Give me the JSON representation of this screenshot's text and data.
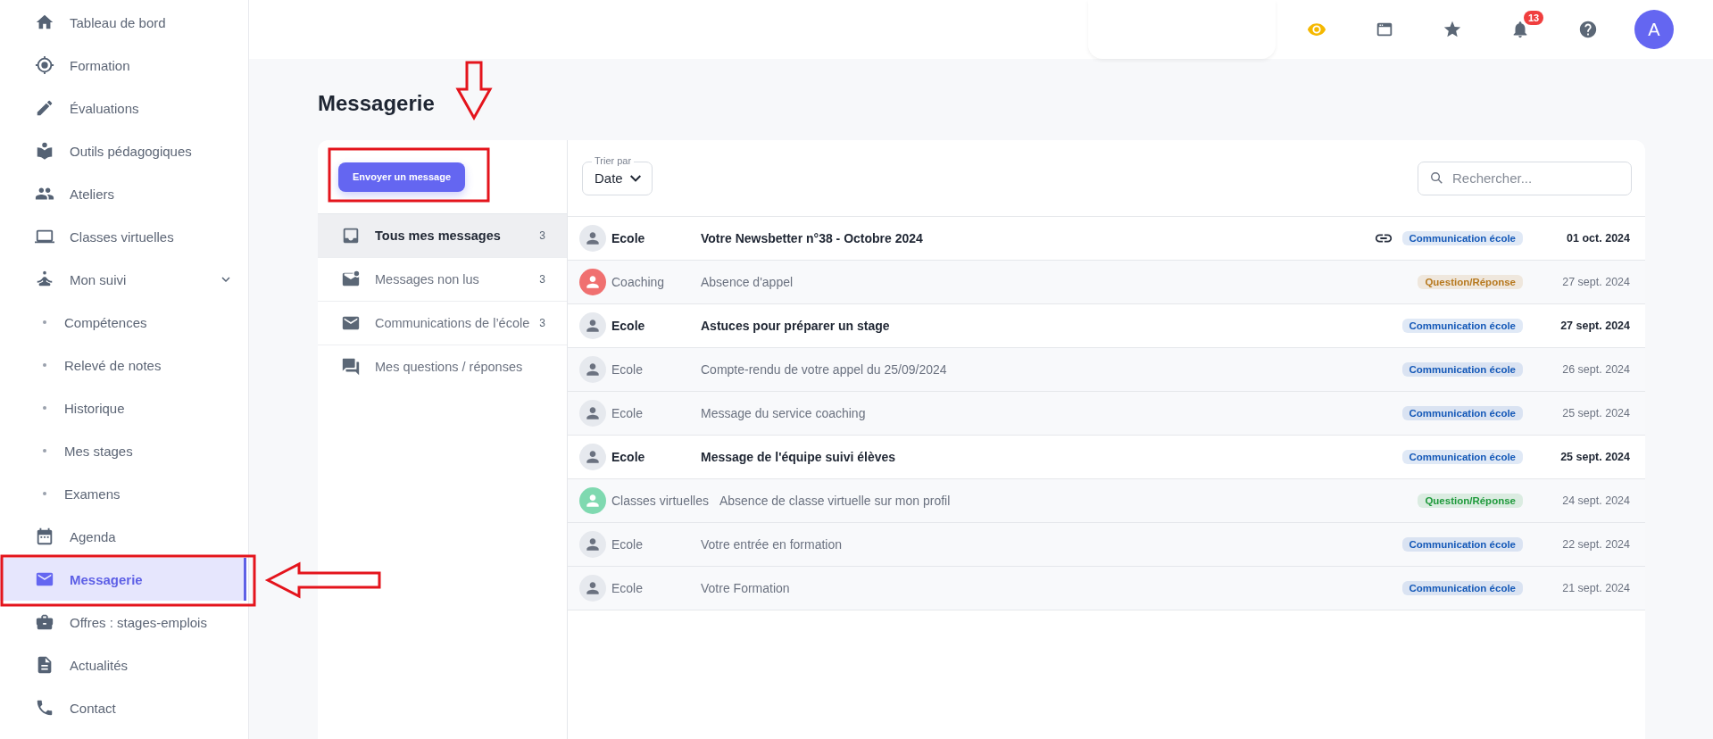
{
  "sidebar": {
    "items": [
      {
        "label": "Tableau de bord",
        "kind": "link",
        "selected": false
      },
      {
        "label": "Formation",
        "kind": "link",
        "selected": false
      },
      {
        "label": "Évaluations",
        "kind": "link",
        "selected": false
      },
      {
        "label": "Outils pédagogiques",
        "kind": "link",
        "selected": false
      },
      {
        "label": "Ateliers",
        "kind": "link",
        "selected": false
      },
      {
        "label": "Classes virtuelles",
        "kind": "link",
        "selected": false
      },
      {
        "label": "Mon suivi",
        "kind": "group",
        "selected": false,
        "expanded": true,
        "children": [
          {
            "label": "Compétences",
            "selected": false
          },
          {
            "label": "Relevé de notes",
            "selected": false
          },
          {
            "label": "Historique",
            "selected": false
          },
          {
            "label": "Mes stages",
            "selected": false
          },
          {
            "label": "Examens",
            "selected": false
          }
        ]
      },
      {
        "label": "Agenda",
        "kind": "link",
        "selected": false
      },
      {
        "label": "Messagerie",
        "kind": "link",
        "selected": true
      },
      {
        "label": "Offres : stages-emplois",
        "kind": "link",
        "selected": false
      },
      {
        "label": "Actualités",
        "kind": "link",
        "selected": false
      },
      {
        "label": "Contact",
        "kind": "link",
        "selected": false
      }
    ]
  },
  "header": {
    "notification_count": "13",
    "avatar_letter": "A"
  },
  "page": {
    "title": "Messagerie"
  },
  "compose_button": "Envoyer un message",
  "folders": [
    {
      "label": "Tous mes messages",
      "count": "3",
      "selected": true
    },
    {
      "label": "Messages non lus",
      "count": "3",
      "selected": false
    },
    {
      "label": "Communications de l’école",
      "count": "3",
      "selected": false
    },
    {
      "label": "Mes questions / réponses",
      "selected": false
    }
  ],
  "sort": {
    "label": "Trier par",
    "value": "Date"
  },
  "search": {
    "placeholder": "Rechercher..."
  },
  "messages": [
    {
      "sender": "Ecole",
      "kind": "default",
      "subject": "Votre Newsbetter n°38 - Octobre 2024",
      "unread": true,
      "attachment": true,
      "tag": {
        "label": "Communication école",
        "color": "#1559b8"
      },
      "date": "01 oct. 2024"
    },
    {
      "sender": "Coaching",
      "kind": "coach",
      "subject": "Absence d'appel",
      "unread": false,
      "attachment": false,
      "tag": {
        "label": "Question/Réponse",
        "color": "#b7791f"
      },
      "date": "27 sept. 2024"
    },
    {
      "sender": "Ecole",
      "kind": "default",
      "subject": "Astuces pour préparer un stage",
      "unread": true,
      "attachment": false,
      "tag": {
        "label": "Communication école",
        "color": "#1559b8"
      },
      "date": "27 sept. 2024"
    },
    {
      "sender": "Ecole",
      "kind": "default",
      "subject": "Compte-rendu de votre appel du 25/09/2024",
      "unread": false,
      "attachment": false,
      "tag": {
        "label": "Communication école",
        "color": "#1559b8"
      },
      "date": "26 sept. 2024"
    },
    {
      "sender": "Ecole",
      "kind": "default",
      "subject": "Message du service coaching",
      "unread": false,
      "attachment": false,
      "tag": {
        "label": "Communication école",
        "color": "#1559b8"
      },
      "date": "25 sept. 2024"
    },
    {
      "sender": "Ecole",
      "kind": "default",
      "subject": "Message de l'équipe suivi élèves",
      "unread": true,
      "attachment": false,
      "tag": {
        "label": "Communication école",
        "color": "#1559b8"
      },
      "date": "25 sept. 2024"
    },
    {
      "sender": "Classes virtuelles",
      "kind": "teacher",
      "subject": "Absence de classe virtuelle sur mon profil",
      "unread": false,
      "attachment": false,
      "tag": {
        "label": "Question/Réponse",
        "color": "#1f9a3c"
      },
      "date": "24 sept. 2024"
    },
    {
      "sender": "Ecole",
      "kind": "default",
      "subject": "Votre entrée en formation",
      "unread": false,
      "attachment": false,
      "tag": {
        "label": "Communication école",
        "color": "#1559b8"
      },
      "date": "22 sept. 2024"
    },
    {
      "sender": "Ecole",
      "kind": "default",
      "subject": "Votre Formation",
      "unread": false,
      "attachment": false,
      "tag": {
        "label": "Communication école",
        "color": "#1559b8"
      },
      "date": "21 sept. 2024"
    }
  ]
}
